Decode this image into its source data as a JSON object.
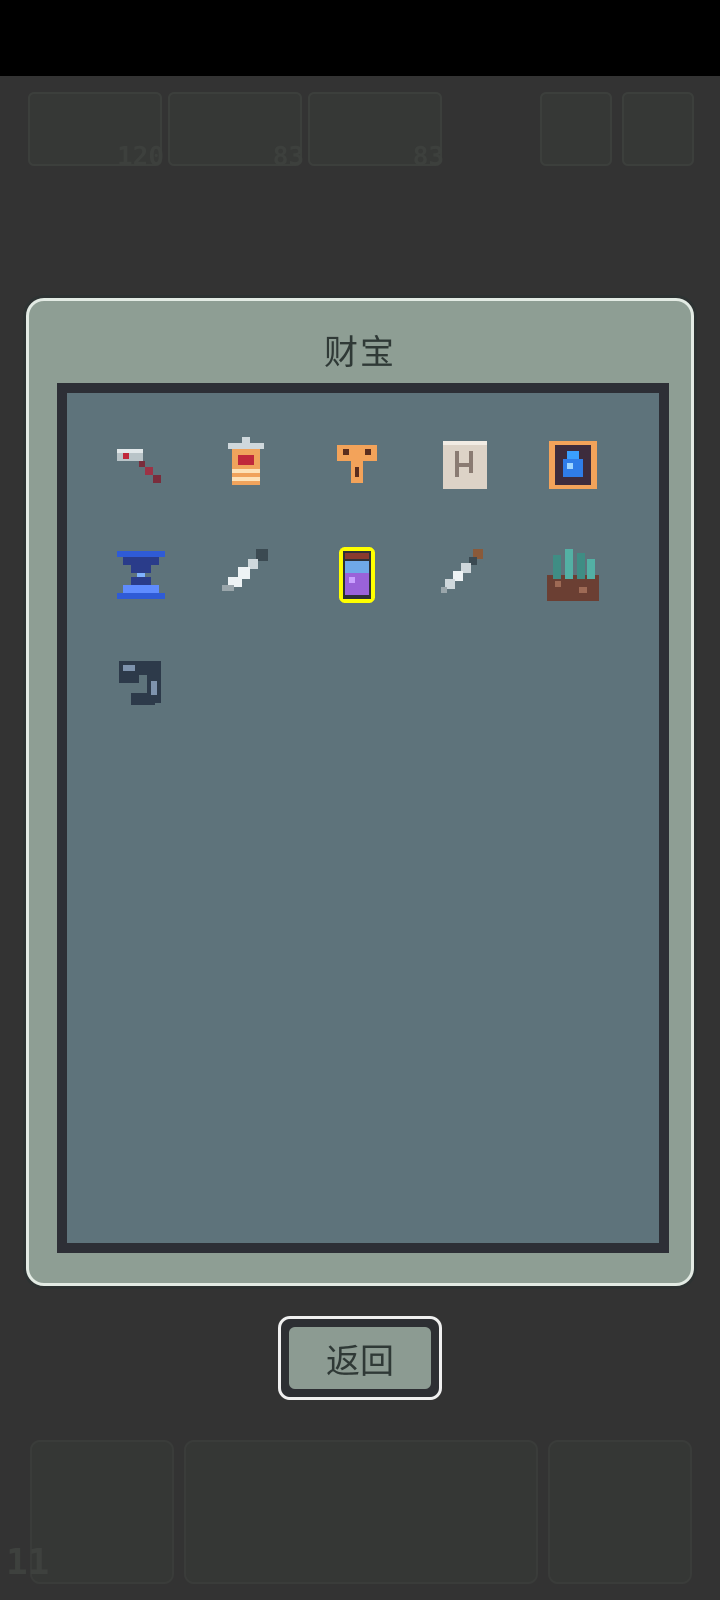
{
  "dialog": {
    "title": "财宝",
    "back_label": "返回",
    "selected_index": 7,
    "items": [
      {
        "icon": "hammer-icon"
      },
      {
        "icon": "lantern-icon"
      },
      {
        "icon": "totem-icon"
      },
      {
        "icon": "map-scroll-icon"
      },
      {
        "icon": "water-tome-icon"
      },
      {
        "icon": "hourglass-icon"
      },
      {
        "icon": "knife-icon"
      },
      {
        "icon": "potion-jar-icon"
      },
      {
        "icon": "dagger-icon"
      },
      {
        "icon": "crystal-rock-icon"
      },
      {
        "icon": "gauntlet-icon"
      }
    ]
  },
  "hud": {
    "resources": [
      {
        "icon": "demon-icon",
        "count": "120"
      },
      {
        "icon": "imp-icon",
        "count": "83"
      },
      {
        "icon": "slime-icon",
        "count": "83"
      }
    ],
    "level": "11"
  },
  "colors": {
    "background": "#333333",
    "panel": "#8e9e94",
    "grid_background": "#5e737b",
    "selection": "#ffff00"
  }
}
